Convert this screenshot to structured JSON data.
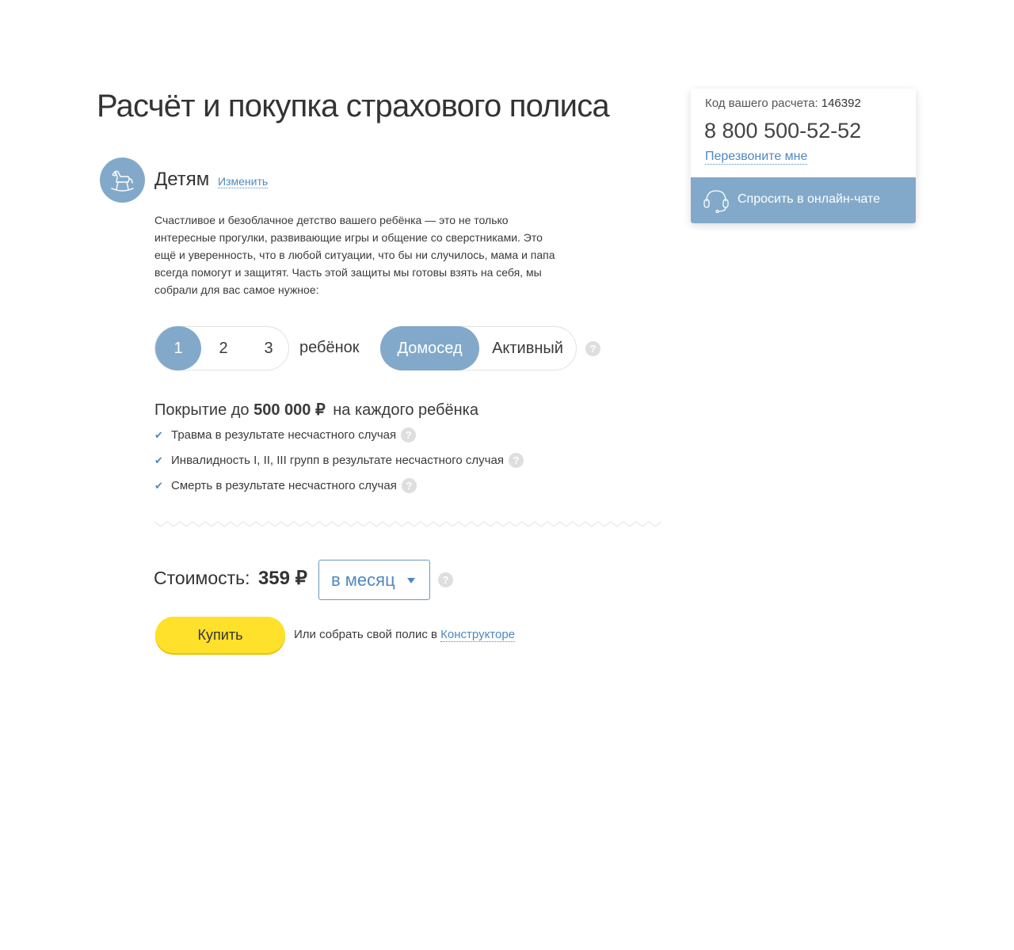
{
  "page": {
    "title": "Расчёт и покупка страхового полиса"
  },
  "category": {
    "icon": "rocking-horse-icon",
    "title": "Детям",
    "change_link": "Изменить",
    "description": "Счастливое и безоблачное детство вашего ребёнка — это не только интересные прогулки, развивающие игры и общение со сверстниками. Это ещё и уверенность, что в любой ситуации, что бы ни случилось, мама и папа всегда помогут и защитят. Часть этой защиты мы готовы взять на себя, мы собрали для вас самое нужное:"
  },
  "children_count": {
    "options": [
      "1",
      "2",
      "3"
    ],
    "selected": "1",
    "unit_label": "ребёнок"
  },
  "lifestyle": {
    "options": [
      "Домосед",
      "Активный"
    ],
    "selected": "Домосед"
  },
  "coverage": {
    "prefix": "Покрытие до",
    "amount": "500 000 ₽",
    "suffix": "на каждого ребёнка",
    "risks": [
      "Травма в результате несчастного случая",
      "Инвалидность I, II, III групп в результате несчастного случая",
      "Смерть в результате несчастного случая"
    ]
  },
  "cost": {
    "label": "Стоимость:",
    "value": "359 ₽",
    "period": "в месяц"
  },
  "actions": {
    "buy_label": "Купить",
    "constructor_text": "Или собрать свой полис в",
    "constructor_link": "Конструкторе"
  },
  "contact": {
    "code_label": "Код вашего расчета:",
    "code_value": "146392",
    "phone": "8 800 500-52-52",
    "callback_link": "Перезвоните мне",
    "chat_label": "Спросить в онлайн-чате"
  },
  "help_symbol": "?",
  "colors": {
    "accent": "#82a9ca",
    "link": "#4f88bf",
    "buy_button": "#ffe02a",
    "help_badge": "#dedede"
  }
}
